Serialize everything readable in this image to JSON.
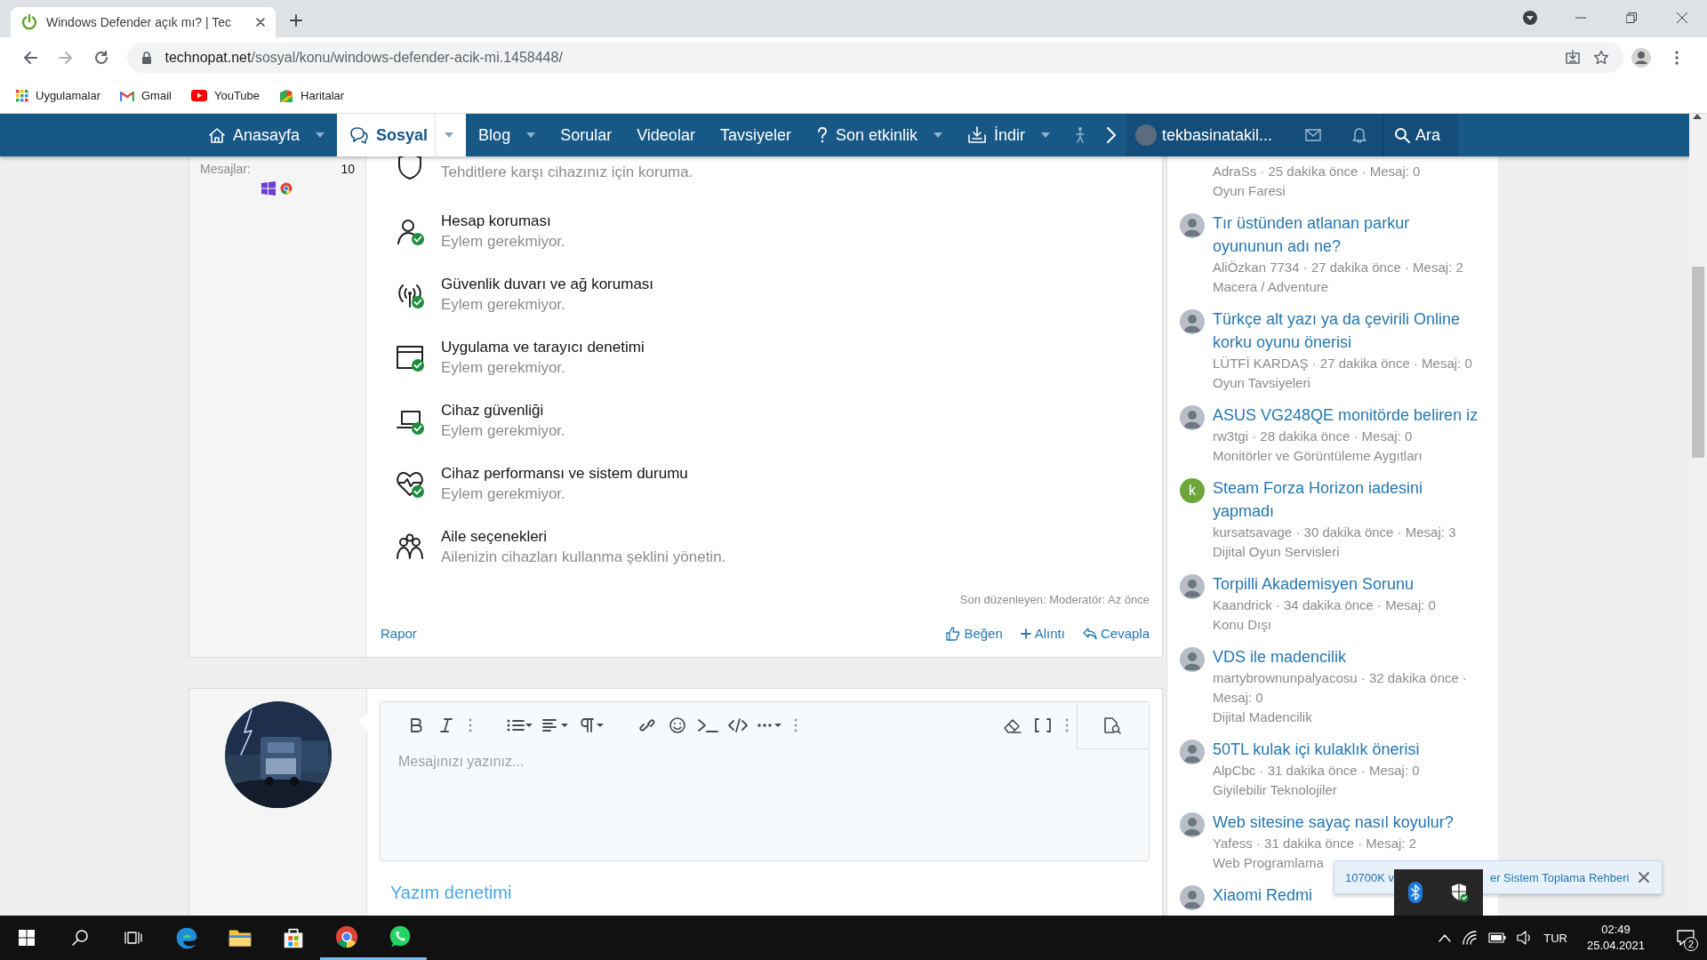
{
  "browser": {
    "tab": {
      "title": "Windows Defender açık mı? | Tec"
    },
    "url": {
      "host": "technopat.net",
      "path": "/sosyal/konu/windows-defender-acik-mi.1458448/"
    },
    "bookmarks": [
      "Uygulamalar",
      "Gmail",
      "YouTube",
      "Haritalar"
    ]
  },
  "nav": {
    "items": [
      {
        "label": "Anasayfa",
        "selected": false,
        "has_menu": true
      },
      {
        "label": "Sosyal",
        "selected": true,
        "has_menu": true
      },
      {
        "label": "Blog",
        "selected": false,
        "has_menu": true
      },
      {
        "label": "Sorular",
        "selected": false,
        "has_menu": false
      },
      {
        "label": "Videolar",
        "selected": false,
        "has_menu": false
      },
      {
        "label": "Tavsiyeler",
        "selected": false,
        "has_menu": false
      },
      {
        "label": "Son etkinlik",
        "selected": false,
        "has_menu": true
      },
      {
        "label": "İndir",
        "selected": false,
        "has_menu": true
      }
    ],
    "user": "tekbasinatakil...",
    "search": "Ara"
  },
  "post": {
    "user_stats": {
      "label": "Mesajlar:",
      "value": "10"
    },
    "items": [
      {
        "status": "Tehditlere karşı cihazınız için koruma.",
        "ok": false
      },
      {
        "title": "Hesap koruması",
        "status": "Eylem gerekmiyor.",
        "ok": true
      },
      {
        "title": "Güvenlik duvarı ve ağ koruması",
        "status": "Eylem gerekmiyor.",
        "ok": true
      },
      {
        "title": "Uygulama ve tarayıcı denetimi",
        "status": "Eylem gerekmiyor.",
        "ok": true
      },
      {
        "title": "Cihaz güvenliği",
        "status": "Eylem gerekmiyor.",
        "ok": true
      },
      {
        "title": "Cihaz performansı ve sistem durumu",
        "status": "Eylem gerekmiyor.",
        "ok": true
      },
      {
        "title": "Aile seçenekleri",
        "status": "Ailenizin cihazları kullanma şeklini yönetin.",
        "ok": false
      }
    ],
    "edited": "Son düzenleyen: Moderatör: Az önce",
    "report": "Rapor",
    "actions": [
      "Beğen",
      "Alıntı",
      "Cevapla"
    ]
  },
  "editor": {
    "placeholder": "Mesajınızı yazınız...",
    "spellcheck": "Yazım denetimi"
  },
  "sidebar": {
    "threads": [
      {
        "meta": "AdraSs · 25 dakika önce · Mesaj: 0",
        "category": "Oyun Faresi"
      },
      {
        "title": "Tır üstünden atlanan parkur oyununun adı ne?",
        "meta": "AliÖzkan 7734 · 27 dakika önce · Mesaj: 2",
        "category": "Macera / Adventure"
      },
      {
        "title": "Türkçe alt yazı ya da çevirili Online korku oyunu önerisi",
        "meta": "LÜTFİ KARDAŞ · 27 dakika önce · Mesaj: 0",
        "category": "Oyun Tavsiyeleri"
      },
      {
        "title": "ASUS VG248QE monitörde beliren iz",
        "meta": "rw3tgi · 28 dakika önce · Mesaj: 0",
        "category": "Monitörler ve Görüntüleme Aygıtları"
      },
      {
        "avatar": {
          "kind": "letter",
          "letter": "k",
          "color": "#6fa63a"
        },
        "title": "Steam Forza Horizon iadesini yapmadı",
        "meta": "kursatsavage · 30 dakika önce · Mesaj: 3",
        "category": "Dijital Oyun Servisleri"
      },
      {
        "title": "Torpilli Akademisyen Sorunu",
        "meta": "Kaandrick · 34 dakika önce · Mesaj: 0",
        "category": "Konu Dışı"
      },
      {
        "title": "VDS ile madencilik",
        "meta": "martybrownunpalyacosu · 32 dakika önce · Mesaj: 0",
        "category": "Dijital Madencilik"
      },
      {
        "title": "50TL kulak içi kulaklık önerisi",
        "meta": "AlpCbc · 31 dakika önce · Mesaj: 0",
        "category": "Giyilebilir Teknolojiler"
      },
      {
        "title": "Web sitesine sayaç nasıl koyulur?",
        "meta": "Yafess · 31 dakika önce · Mesaj: 2",
        "category": "Web Programlama"
      },
      {
        "title": "Xiaomi Redmi"
      }
    ]
  },
  "toast": {
    "text_before": "10700K v",
    "text_after": "er Sistem Toplama Rehberi"
  },
  "taskbar": {
    "apps": [
      {
        "running": false
      },
      {
        "running": false
      },
      {
        "running": false
      },
      {
        "running": true
      },
      {
        "running": true
      }
    ],
    "language": "TUR",
    "time": "02:49",
    "date": "25.04.2021",
    "notifications": "2"
  }
}
